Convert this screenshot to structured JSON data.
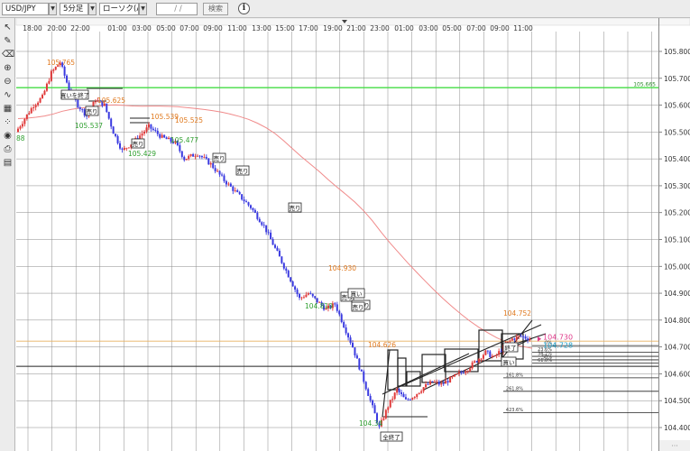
{
  "toolbar": {
    "symbol": "USD/JPY",
    "timeframe": "5分足",
    "chart_type": "ローソク(ASK)",
    "date_value": "/ /",
    "search_label": "検索",
    "info_glyph": "i"
  },
  "left_tools": [
    {
      "name": "cursor-icon",
      "glyph": "↖"
    },
    {
      "name": "pen-icon",
      "glyph": "✎"
    },
    {
      "name": "eraser-icon",
      "glyph": "⌫"
    },
    {
      "name": "zoom-in-icon",
      "glyph": "⊕"
    },
    {
      "name": "zoom-out-icon",
      "glyph": "⊖"
    },
    {
      "name": "chart-icon",
      "glyph": "∿"
    },
    {
      "name": "grid-icon",
      "glyph": "▦"
    },
    {
      "name": "dots-icon",
      "glyph": "⁘"
    },
    {
      "name": "eye-icon",
      "glyph": "◉"
    },
    {
      "name": "print-icon",
      "glyph": "⎙"
    },
    {
      "name": "settings-icon",
      "glyph": "▤"
    }
  ],
  "chart_data": {
    "type": "candlestick",
    "x_ticks": [
      "18:00",
      "20:00",
      "22:00",
      "01:00",
      "03:00",
      "05:00",
      "07:00",
      "09:00",
      "11:00",
      "13:00",
      "15:00",
      "17:00",
      "19:00",
      "21:00",
      "23:00",
      "01:00",
      "03:00",
      "05:00",
      "07:00",
      "09:00",
      "11:00"
    ],
    "y_ticks": [
      105.8,
      105.7,
      105.6,
      105.5,
      105.4,
      105.3,
      105.2,
      105.1,
      105.0,
      104.9,
      104.8,
      104.7,
      104.6,
      104.5,
      104.4
    ],
    "ylim": [
      104.38,
      105.86
    ],
    "price_line": {
      "value": 105.665,
      "label": "105.665",
      "color": "#44dd44"
    },
    "ask_line": {
      "value": 104.725,
      "color": "#e8b060"
    },
    "current": {
      "ask": "104.730",
      "bid": "104.728",
      "ask_color": "#e03a8a",
      "bid_color": "#22a0c8"
    },
    "fib_levels": [
      {
        "label": "0%",
        "value": 104.705
      },
      {
        "label": "23.6%",
        "value": 104.68
      },
      {
        "label": "38.2%",
        "value": 104.665
      },
      {
        "label": "50%",
        "value": 104.652
      },
      {
        "label": "61.8%",
        "value": 104.64
      },
      {
        "label": "161.8%",
        "value": 104.585
      },
      {
        "label": "261.8%",
        "value": 104.535
      },
      {
        "label": "423.6%",
        "value": 104.455
      }
    ],
    "high_low_labels": [
      {
        "text": "105.765",
        "price": 105.765,
        "color": "#e07a20"
      },
      {
        "text": "105.537",
        "price": 105.537,
        "color": "#30a030"
      },
      {
        "text": "105.625",
        "price": 105.625,
        "color": "#e07a20"
      },
      {
        "text": "105.539",
        "price": 105.539,
        "color": "#e07a20"
      },
      {
        "text": "105.525",
        "price": 105.525,
        "color": "#e07a20"
      },
      {
        "text": "105.429",
        "price": 105.429,
        "color": "#30a030"
      },
      {
        "text": "105.477",
        "price": 105.477,
        "color": "#30a030"
      },
      {
        "text": "104.930",
        "price": 104.93,
        "color": "#e07a20"
      },
      {
        "text": "104.819",
        "price": 104.819,
        "color": "#30a030"
      },
      {
        "text": "104.626",
        "price": 104.626,
        "color": "#e07a20"
      },
      {
        "text": "104.34",
        "price": 104.34,
        "color": "#30a030"
      },
      {
        "text": "104.752",
        "price": 104.752,
        "color": "#e07a20"
      },
      {
        "text": "88",
        "price": 105.49,
        "color": "#30a030"
      }
    ],
    "trade_markers": [
      "買いを終了",
      "売り",
      "売り",
      "売り",
      "売り",
      "売り",
      "売り",
      "買い",
      "損切り",
      "売り",
      "全終了",
      "終了",
      "買い"
    ]
  }
}
